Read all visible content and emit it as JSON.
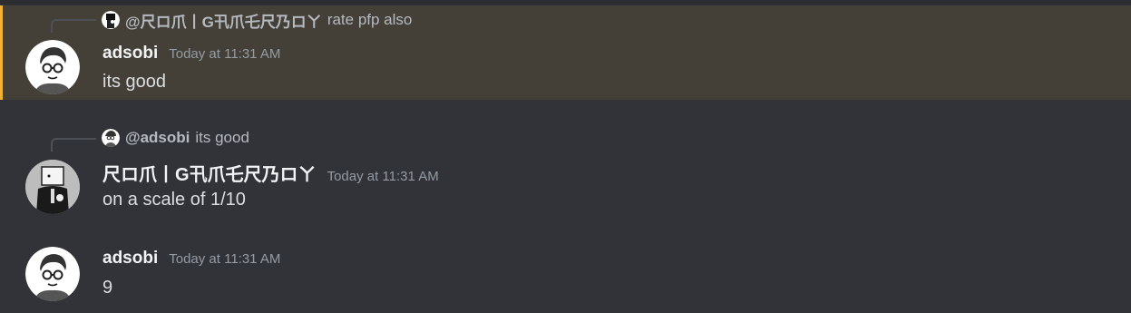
{
  "messages": [
    {
      "reply": {
        "name": "@尺ロ爪丨G卂爪乇尺乃ロㄚ",
        "text": "rate pfp also"
      },
      "author": "adsobi",
      "timestamp": "Today at 11:31 AM",
      "content": "its good",
      "highlighted": true
    },
    {
      "reply": {
        "name": "@adsobi",
        "text": "its good"
      },
      "author": "尺ロ爪丨G卂爪乇尺乃ロㄚ",
      "timestamp": "Today at 11:31 AM",
      "content": "on a scale of 1/10"
    },
    {
      "author": "adsobi",
      "timestamp": "Today at 11:31 AM",
      "content": "9"
    }
  ],
  "colors": {
    "mention_highlight": "#f0b232",
    "background": "#313338"
  }
}
